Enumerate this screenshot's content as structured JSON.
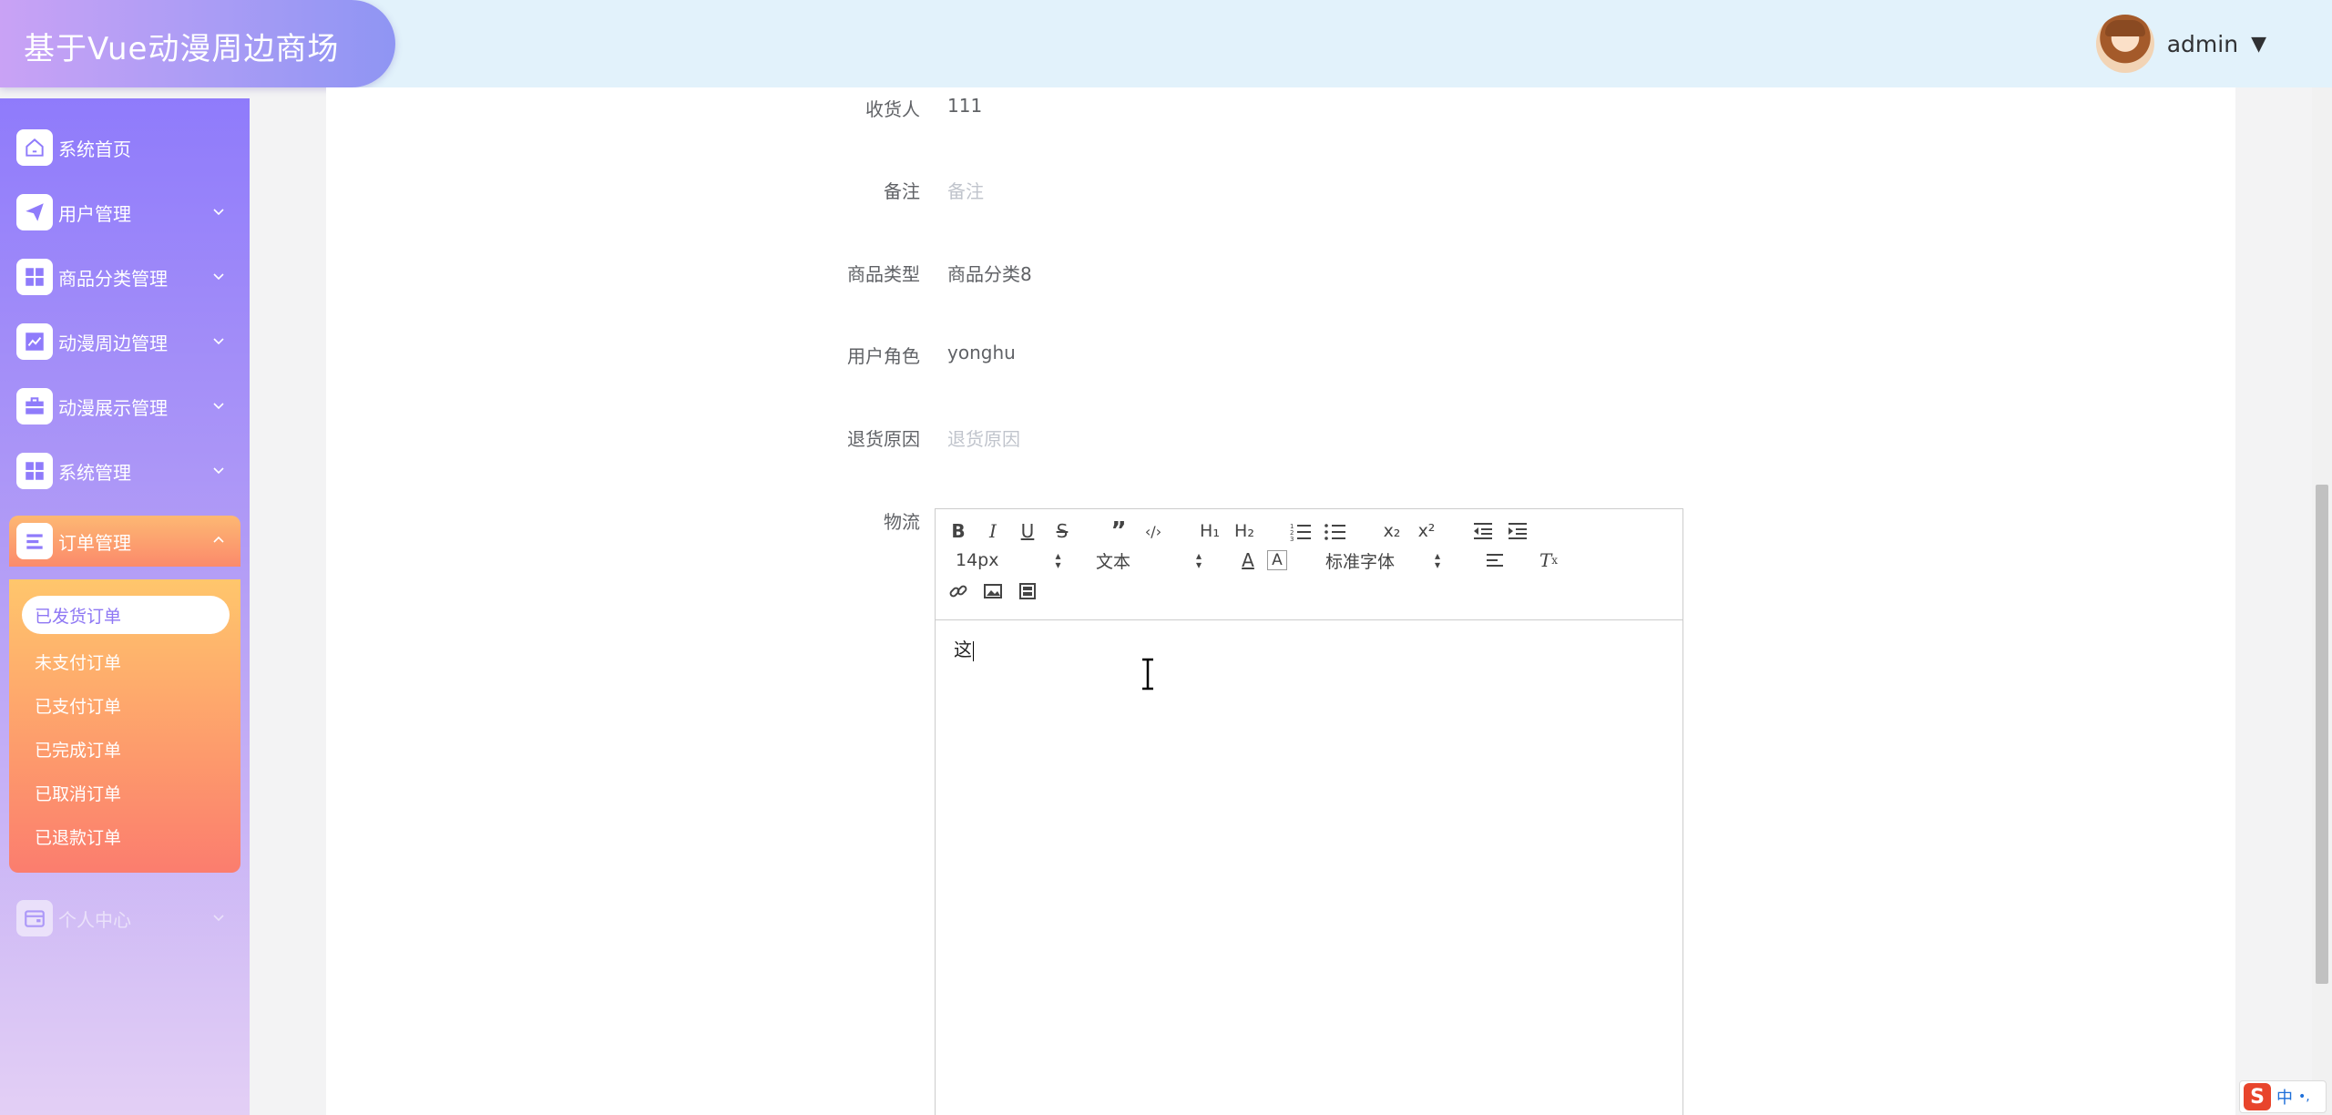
{
  "header": {
    "title": "基于Vue动漫周边商场",
    "username": "admin",
    "caret": "▼"
  },
  "sidebar": {
    "items": [
      {
        "label": "系统首页",
        "icon": "home-icon"
      },
      {
        "label": "用户管理",
        "icon": "send-icon"
      },
      {
        "label": "商品分类管理",
        "icon": "grid-icon"
      },
      {
        "label": "动漫周边管理",
        "icon": "chart-icon"
      },
      {
        "label": "动漫展示管理",
        "icon": "briefcase-icon"
      },
      {
        "label": "系统管理",
        "icon": "grid-icon"
      },
      {
        "label": "订单管理",
        "icon": "list-icon"
      },
      {
        "label": "个人中心",
        "icon": "wallet-icon"
      }
    ],
    "submenu": [
      "已发货订单",
      "未支付订单",
      "已支付订单",
      "已完成订单",
      "已取消订单",
      "已退款订单"
    ]
  },
  "form": {
    "receiver_label": "收货人",
    "receiver_value": "111",
    "remark_label": "备注",
    "remark_placeholder": "备注",
    "category_label": "商品类型",
    "category_value": "商品分类8",
    "role_label": "用户角色",
    "role_value": "yonghu",
    "refund_label": "退货原因",
    "refund_placeholder": "退货原因",
    "logistics_label": "物流"
  },
  "editor": {
    "font_size": "14px",
    "header_select": "文本",
    "font_family": "标准字体",
    "content": "这"
  },
  "ime": {
    "logo": "S",
    "mode": "中",
    "punct": "•,"
  },
  "colors": {
    "sidebar_top": "#8f7bfb",
    "active_menu": "#fb8a6b",
    "header_bg": "#e2f2fb"
  }
}
